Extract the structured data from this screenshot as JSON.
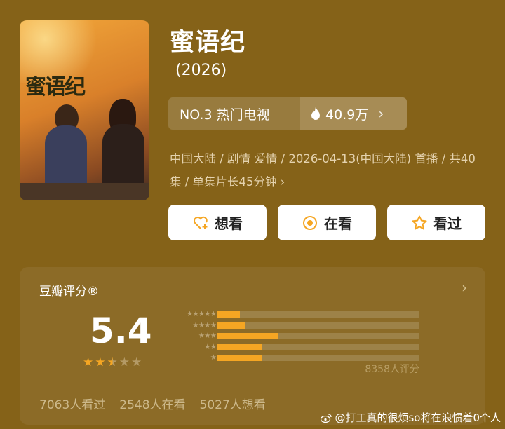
{
  "show": {
    "title": "蜜语纪",
    "year": "(2026)",
    "poster": {
      "title_text": "蜜语纪"
    }
  },
  "ranking": {
    "rank": "NO.3 热门电视",
    "heat": "40.9万"
  },
  "meta": {
    "line": "中国大陆 / 剧情 爱情 / 2026-04-13(中国大陆) 首播 / 共40集 / 单集片长45分钟"
  },
  "actions": {
    "want": "想看",
    "watching": "在看",
    "watched": "看过"
  },
  "rating": {
    "title": "豆瓣评分®",
    "score": "5.4",
    "stars_value": 2.5,
    "distribution": [
      {
        "stars": 5,
        "percent": 11
      },
      {
        "stars": 4,
        "percent": 14
      },
      {
        "stars": 3,
        "percent": 30
      },
      {
        "stars": 2,
        "percent": 22
      },
      {
        "stars": 1,
        "percent": 22
      }
    ],
    "total": "8358人评分",
    "counts": {
      "watched": "7063人看过",
      "watching": "2548人在看",
      "want": "5027人想看"
    }
  },
  "watermark": "@打工真的很烦so将在浪惯着0个人",
  "colors": {
    "background": "#856218",
    "star": "#f5a623",
    "white": "#ffffff"
  }
}
